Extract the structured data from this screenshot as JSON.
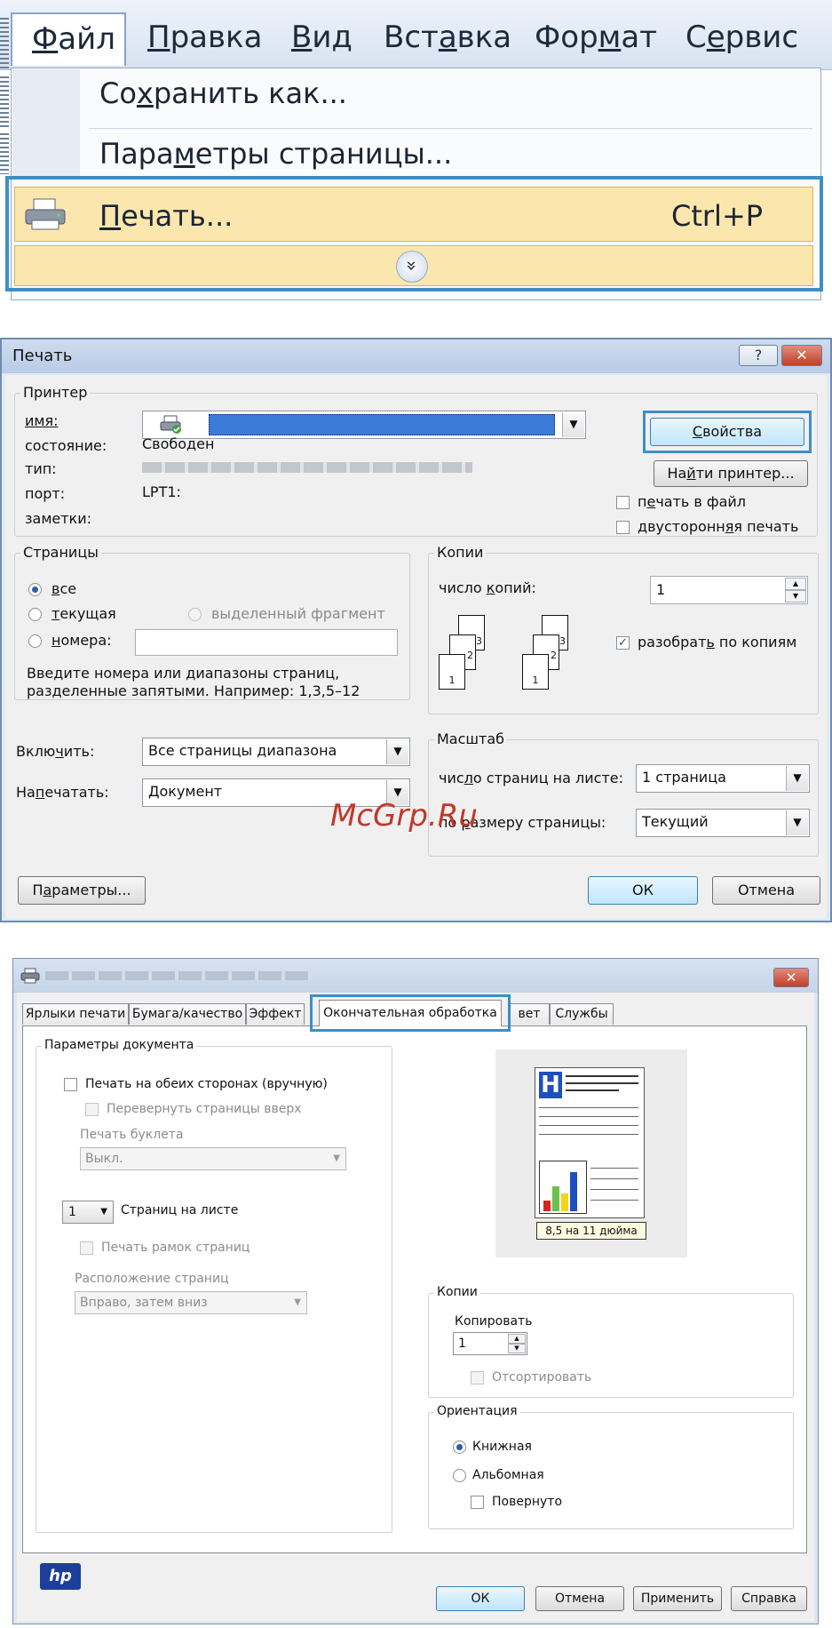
{
  "menu": {
    "tabs": [
      {
        "pre": "",
        "u": "Ф",
        "post": "айл"
      },
      {
        "pre": "",
        "u": "П",
        "post": "равка"
      },
      {
        "pre": "",
        "u": "В",
        "post": "ид"
      },
      {
        "pre": "Вст",
        "u": "а",
        "post": "вка"
      },
      {
        "pre": "Фор",
        "u": "м",
        "post": "ат"
      },
      {
        "pre": "С",
        "u": "е",
        "post": "рвис"
      }
    ],
    "save_as": {
      "pre": "Со",
      "u": "х",
      "post": "ранить как..."
    },
    "page_setup": {
      "pre": "Пара",
      "u": "м",
      "post": "етры страницы..."
    },
    "print": {
      "pre": "",
      "u": "П",
      "post": "ечать..."
    },
    "print_shortcut": "Ctrl+P",
    "expand_glyph": "»"
  },
  "print_dialog": {
    "title": "Печать",
    "help_glyph": "?",
    "close_glyph": "✕",
    "printer_group": "Принтер",
    "name_label": "имя:",
    "status_label": "состояние:",
    "status_value": "Свободен",
    "type_label": "тип:",
    "port_label": "порт:",
    "port_value": "LPT1:",
    "notes_label": "заметки:",
    "properties_btn": {
      "pre": "",
      "u": "С",
      "post": "войства"
    },
    "find_printer_btn": {
      "pre": "На",
      "u": "й",
      "post": "ти принтер..."
    },
    "print_to_file": {
      "pre": "п",
      "u": "е",
      "post": "чать в файл"
    },
    "duplex": {
      "pre": "двусторонн",
      "u": "я",
      "post": "я печать"
    },
    "pages_group": "Страницы",
    "pages_all": {
      "pre": "",
      "u": "в",
      "post": "се"
    },
    "pages_current": {
      "pre": "",
      "u": "т",
      "post": "екущая"
    },
    "pages_selection": "выделенный фрагмент",
    "pages_numbers": {
      "pre": "",
      "u": "н",
      "post": "омера:"
    },
    "pages_hint_1": "Введите номера или диапазоны страниц,",
    "pages_hint_2": "разделенные запятыми. Например: 1,3,5–12",
    "copies_group": "Копии",
    "copies_label": {
      "pre": "число ",
      "u": "к",
      "post": "опий:"
    },
    "copies_value": "1",
    "collate": {
      "pre": "разобрат",
      "u": "ь",
      "post": " по копиям"
    },
    "page_nums": [
      "1",
      "2",
      "3"
    ],
    "include_label": {
      "pre": "Вклю",
      "u": "ч",
      "post": "ить:"
    },
    "include_value": "Все страницы диапазона",
    "print_what_label": {
      "pre": "На",
      "u": "п",
      "post": "ечатать:"
    },
    "print_what_value": "Документ",
    "scale_group": "Масштаб",
    "pages_per_sheet_label": {
      "pre": "чис",
      "u": "л",
      "post": "о страниц на листе:"
    },
    "pages_per_sheet_value": "1 страница",
    "fit_label": {
      "pre": "по ",
      "u": "р",
      "post": "азмеру страницы:"
    },
    "fit_value": "Текущий",
    "options_btn": {
      "pre": "П",
      "u": "а",
      "post": "раметры..."
    },
    "ok_btn": "ОК",
    "cancel_btn": "Отмена",
    "combo_arrow": "▼",
    "spin_up": "▲",
    "spin_down": "▼",
    "check_glyph": "✓"
  },
  "watermark": "McGrp.Ru",
  "props_dialog": {
    "close_glyph": "✕",
    "tabs": [
      "Ярлыки печати",
      "Бумага/качество",
      "Эффект",
      "Окончательная обработка",
      "вет",
      "Службы"
    ],
    "doc_options_group": "Параметры документа",
    "duplex_manual": "Печать на обеих сторонах (вручную)",
    "flip_pages": "Перевернуть страницы вверх",
    "booklet_label": "Печать буклета",
    "booklet_value": "Выкл.",
    "pages_per_sheet_value": "1",
    "pages_per_sheet_label": "Страниц на листе",
    "print_borders": "Печать рамок страниц",
    "page_order_label": "Расположение страниц",
    "page_order_value": "Вправо, затем вниз",
    "paper_size": "8,5 на 11 дюйма",
    "preview_letter": "H",
    "copies_group": "Копии",
    "copies_label": "Копировать",
    "copies_value": "1",
    "collate": "Отсортировать",
    "orientation_group": "Ориентация",
    "portrait": "Книжная",
    "landscape": "Альбомная",
    "rotated": "Повернуто",
    "hp_logo": "hp",
    "ok_btn": "ОК",
    "cancel_btn": "Отмена",
    "apply_btn": "Применить",
    "help_btn": "Справка",
    "combo_arrow": "▼"
  },
  "colors": {
    "highlight_blue": "#3d8ec4",
    "menu_hover": "#fbe7ad",
    "chart_blue": "#1f4fbf",
    "chart_green": "#6cc24a",
    "chart_yellow": "#f2d21b",
    "chart_red": "#d9231f"
  }
}
